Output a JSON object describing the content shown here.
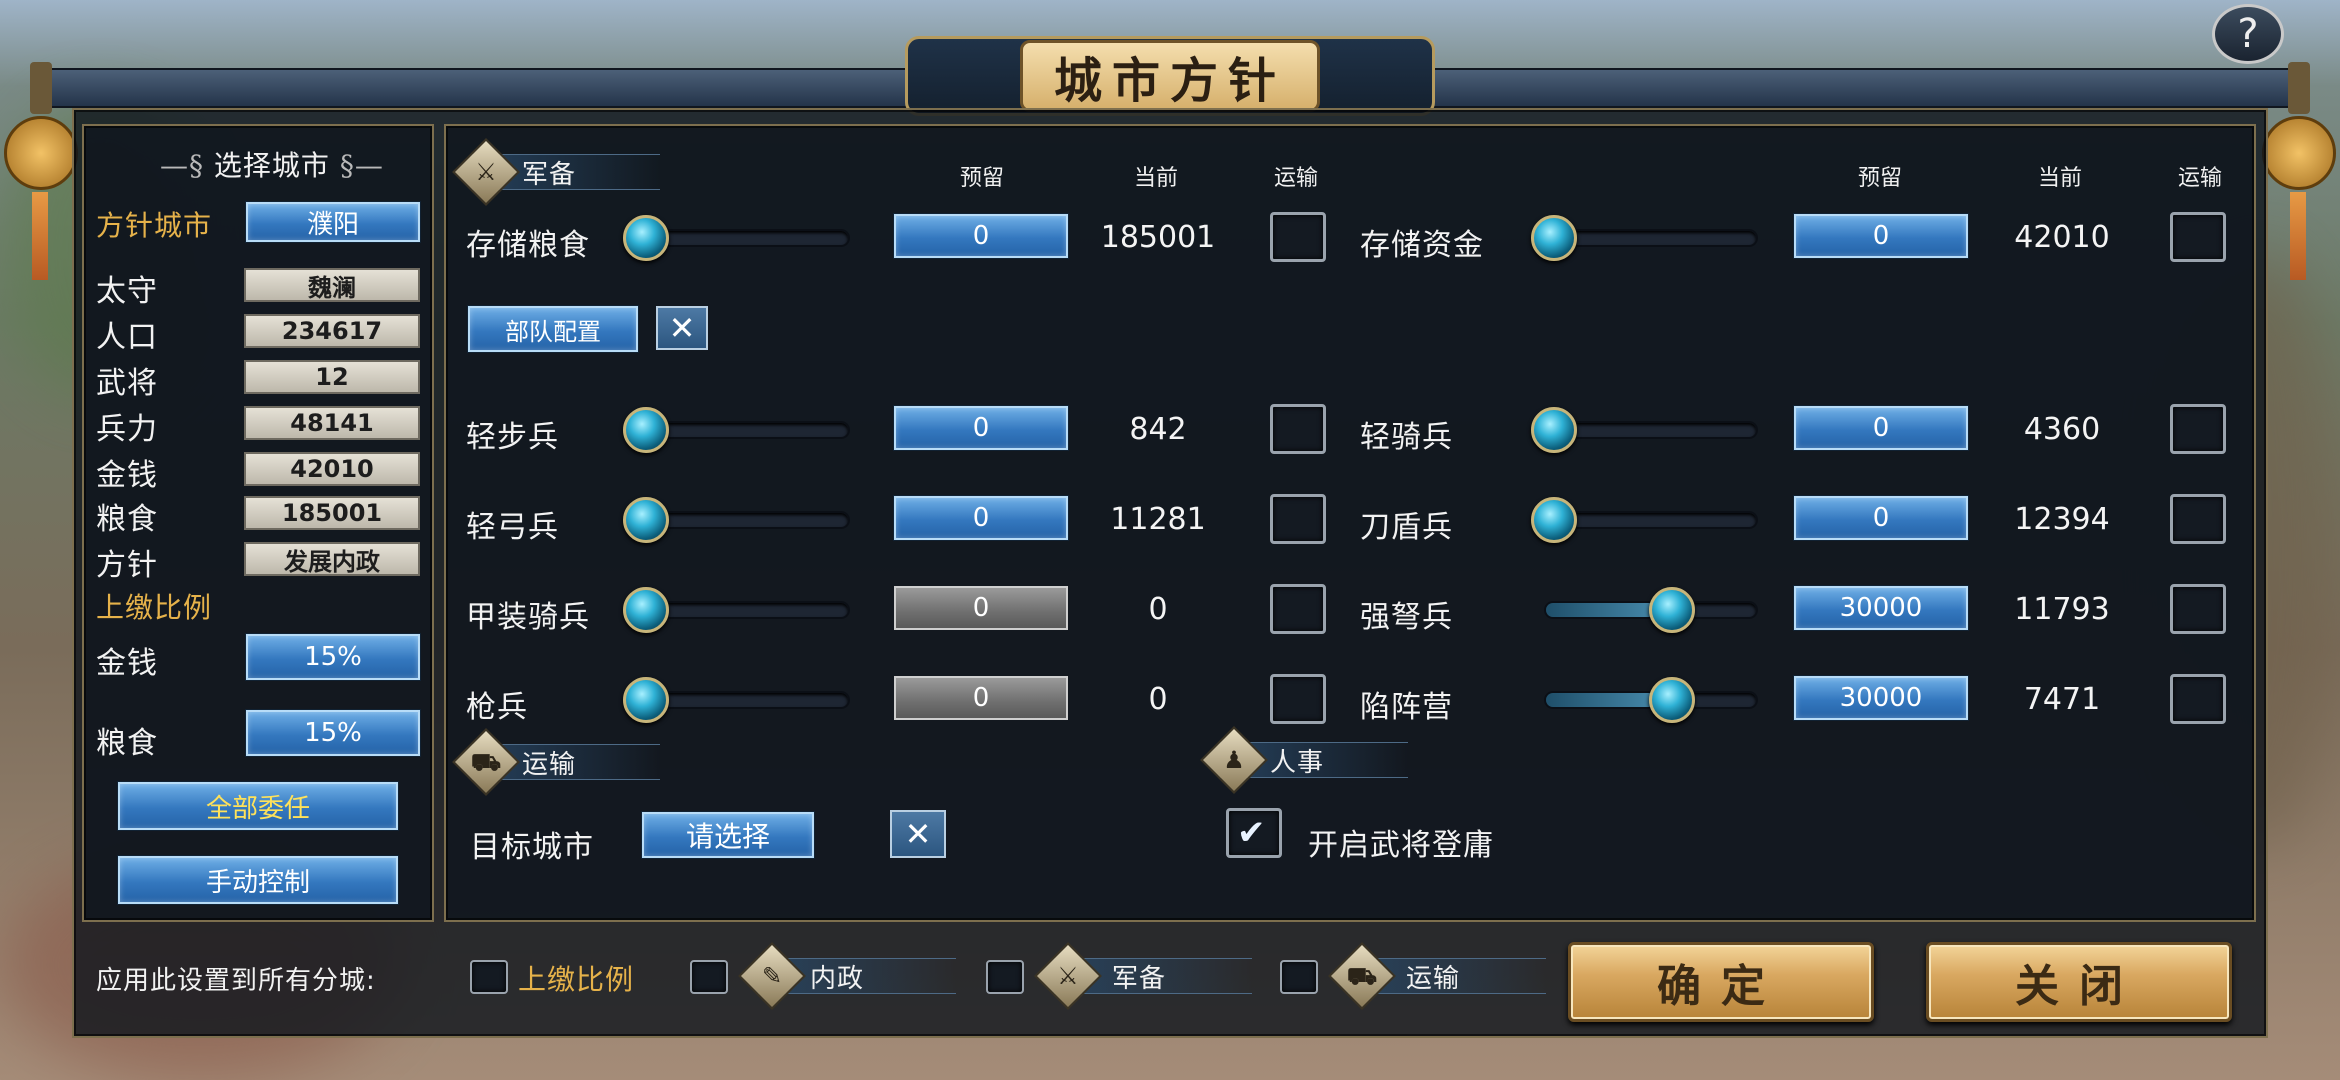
{
  "title": "城市方针",
  "help_label": "?",
  "left": {
    "header": "选择城市",
    "policy_city_label": "方针城市",
    "policy_city_value": "濮阳",
    "stats": [
      {
        "label": "太守",
        "value": "魏澜"
      },
      {
        "label": "人口",
        "value": "234617"
      },
      {
        "label": "武将",
        "value": "12"
      },
      {
        "label": "兵力",
        "value": "48141"
      },
      {
        "label": "金钱",
        "value": "42010"
      },
      {
        "label": "粮食",
        "value": "185001"
      },
      {
        "label": "方针",
        "value": "发展内政"
      }
    ],
    "tribute_header": "上缴比例",
    "tribute": [
      {
        "label": "金钱",
        "value": "15%"
      },
      {
        "label": "粮食",
        "value": "15%"
      }
    ],
    "delegate_all": "全部委任",
    "manual_control": "手动控制"
  },
  "military": {
    "section_label": "军备",
    "col_reserve": "预留",
    "col_current": "当前",
    "col_transport": "运输",
    "storage": [
      {
        "label": "存储粮食",
        "reserve": "0",
        "current": "185001",
        "level": 0
      },
      {
        "label": "存储资金",
        "reserve": "0",
        "current": "42010",
        "level": 0
      }
    ],
    "troop_config": "部队配置",
    "units": [
      {
        "label": "轻步兵",
        "reserve": "0",
        "current": "842",
        "level": 0,
        "enabled": true
      },
      {
        "label": "轻骑兵",
        "reserve": "0",
        "current": "4360",
        "level": 0,
        "enabled": true
      },
      {
        "label": "轻弓兵",
        "reserve": "0",
        "current": "11281",
        "level": 0,
        "enabled": true
      },
      {
        "label": "刀盾兵",
        "reserve": "0",
        "current": "12394",
        "level": 0,
        "enabled": true
      },
      {
        "label": "甲装骑兵",
        "reserve": "0",
        "current": "0",
        "level": 0,
        "enabled": false
      },
      {
        "label": "强弩兵",
        "reserve": "30000",
        "current": "11793",
        "level": 0.6,
        "enabled": true
      },
      {
        "label": "枪兵",
        "reserve": "0",
        "current": "0",
        "level": 0,
        "enabled": false
      },
      {
        "label": "陷阵营",
        "reserve": "30000",
        "current": "7471",
        "level": 0.6,
        "enabled": true
      }
    ]
  },
  "transport": {
    "section_label": "运输",
    "target_label": "目标城市",
    "target_value": "请选择"
  },
  "personnel": {
    "section_label": "人事",
    "enable_label": "开启武将登庸",
    "checked": true
  },
  "footer": {
    "apply_label": "应用此设置到所有分城:",
    "tribute": "上缴比例",
    "domestic": "内政",
    "military": "军备",
    "transport": "运输",
    "confirm": "确定",
    "close": "关闭"
  },
  "colors": {
    "accent_gold": "#e6b24a",
    "button_blue": "#3478bf"
  }
}
